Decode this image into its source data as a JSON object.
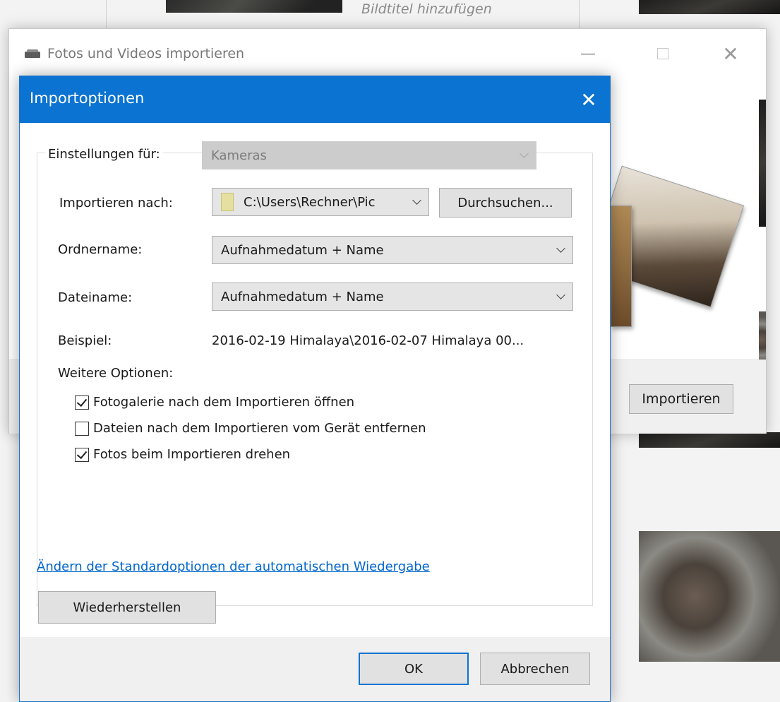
{
  "background": {
    "caption": "Bildtitel hinzufügen"
  },
  "outer_window": {
    "title": "Fotos und Videos importieren",
    "import_button": "Importieren",
    "icons": {
      "app": "drive-icon",
      "minimize": "minimize-icon",
      "maximize": "maximize-icon",
      "close": "close-icon"
    }
  },
  "dialog": {
    "title": "Importoptionen",
    "settings_for_label": "Einstellungen für:",
    "settings_for_value": "Kameras",
    "import_to_label": "Importieren nach:",
    "import_to_value": "C:\\Users\\Rechner\\Pic",
    "browse_button": "Durchsuchen...",
    "folder_name_label": "Ordnername:",
    "folder_name_value": "Aufnahmedatum + Name",
    "file_name_label": "Dateiname:",
    "file_name_value": "Aufnahmedatum + Name",
    "example_label": "Beispiel:",
    "example_value": "2016-02-19 Himalaya\\2016-02-07 Himalaya 00...",
    "more_options_label": "Weitere Optionen:",
    "options": [
      {
        "label": "Fotogalerie nach dem Importieren öffnen",
        "checked": true
      },
      {
        "label": "Dateien nach dem Importieren vom Gerät entfernen",
        "checked": false
      },
      {
        "label": "Fotos beim Importieren drehen",
        "checked": true
      }
    ],
    "autoplay_link": "Ändern der Standardoptionen der automatischen Wiedergabe",
    "restore_button": "Wiederherstellen",
    "ok_button": "OK",
    "cancel_button": "Abbrechen",
    "accent_color": "#0b73d1"
  }
}
